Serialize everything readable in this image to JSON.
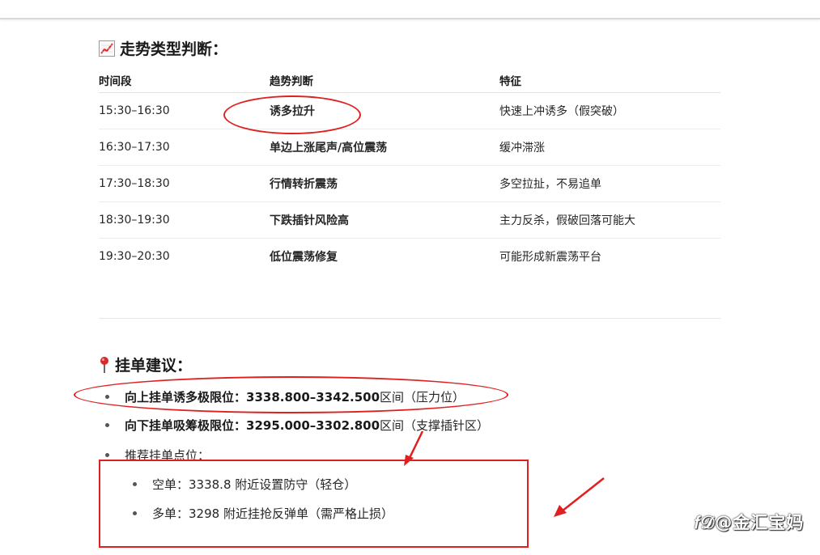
{
  "section1": {
    "icon": "chart-increasing-icon",
    "title": "走势类型判断："
  },
  "table": {
    "headers": [
      "时间段",
      "趋势判断",
      "特征"
    ],
    "rows": [
      {
        "time": "15:30–16:30",
        "trend": "诱多拉升",
        "feature": "快速上冲诱多（假突破）"
      },
      {
        "time": "16:30–17:30",
        "trend": "单边上涨尾声/高位震荡",
        "feature": "缓冲滞涨"
      },
      {
        "time": "17:30–18:30",
        "trend": "行情转折震荡",
        "feature": "多空拉扯，不易追单"
      },
      {
        "time": "18:30–19:30",
        "trend": "下跌插针风险高",
        "feature": "主力反杀，假破回落可能大"
      },
      {
        "time": "19:30–20:30",
        "trend": "低位震荡修复",
        "feature": "可能形成新震荡平台"
      }
    ]
  },
  "section2": {
    "icon": "round-pushpin-icon",
    "title": "挂单建议：",
    "items": [
      {
        "label": "向上挂单诱多极限位：",
        "range": "3338.800–3342.500",
        "note": " 区间（压力位）"
      },
      {
        "label": "向下挂单吸筹极限位：",
        "range": "3295.000–3302.800",
        "note": " 区间（支撑插针区）"
      },
      {
        "text": "推荐挂单点位："
      }
    ],
    "sub_items": [
      "空单：3338.8 附近设置防守（轻仓）",
      "多单：3298 附近挂抢反弹单（需严格止损）"
    ]
  },
  "watermark": "𝑓𝒟@金汇宝妈",
  "colors": {
    "annotation": "#e02020",
    "text": "#262626"
  }
}
